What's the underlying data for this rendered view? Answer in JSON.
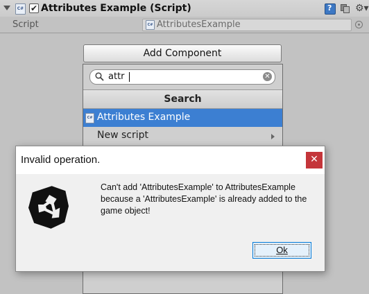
{
  "component": {
    "title": "Attributes Example (Script)",
    "enabled": true,
    "file_icon_text": "C#",
    "check_glyph": "✔",
    "gear_glyph": "⚙▾"
  },
  "script_field": {
    "label": "Script",
    "value": "AttributesExample"
  },
  "add_component": {
    "button_label": "Add Component",
    "search_value": "attr",
    "clear_glyph": "✕",
    "section_header": "Search",
    "items": [
      {
        "label": "Attributes Example",
        "selected": true
      },
      {
        "label": "New script",
        "submenu": true
      }
    ]
  },
  "dialog": {
    "title": "Invalid operation.",
    "close_glyph": "✕",
    "message_lines": [
      "Can't add 'AttributesExample' to AttributesExample",
      "because a 'AttributesExample' is already added to the",
      "game object!"
    ],
    "ok_label": "Ok"
  },
  "colors": {
    "selection": "#3c7fd2",
    "close_red": "#c4353a",
    "inspector_bg": "#c2c2c2"
  }
}
